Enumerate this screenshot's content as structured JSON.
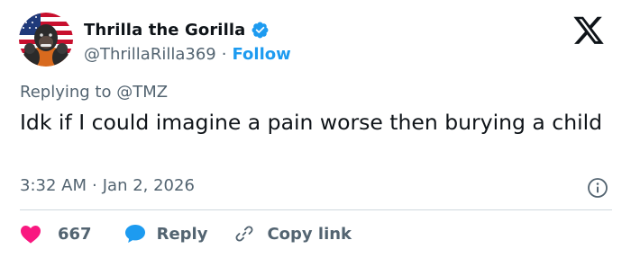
{
  "author": {
    "display_name": "Thrilla the Gorilla",
    "handle": "@ThrillaRilla369",
    "separator": "·",
    "follow_label": "Follow",
    "verified": true
  },
  "reply_context": {
    "prefix": "Replying to",
    "mention": "@TMZ"
  },
  "tweet": {
    "text": "Idk if I could imagine a pain worse then burying a child",
    "time": "3:32 AM",
    "separator": "·",
    "date": "Jan 2, 2026"
  },
  "actions": {
    "like_count": "667",
    "reply_label": "Reply",
    "copy_label": "Copy link"
  },
  "icons": {
    "brand": "x-logo-icon",
    "verified": "verified-badge-icon",
    "info": "info-icon",
    "like": "heart-icon",
    "reply": "speech-bubble-icon",
    "copy": "link-icon"
  },
  "colors": {
    "accent": "#1d9bf0",
    "like": "#f91880",
    "text": "#0f1419",
    "muted": "#536471",
    "divider": "#cfd9de"
  }
}
